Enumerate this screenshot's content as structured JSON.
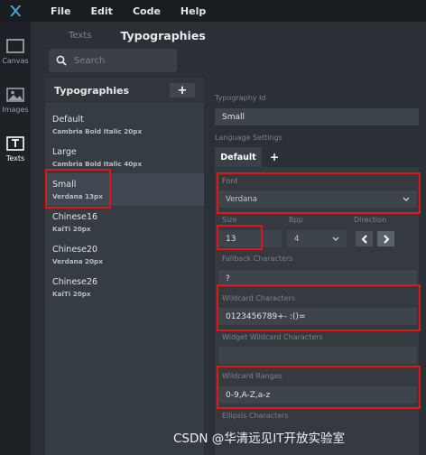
{
  "menu": [
    "File",
    "Edit",
    "Code",
    "Help"
  ],
  "rail": [
    {
      "label": "Canvas",
      "icon": "canvas-icon"
    },
    {
      "label": "Images",
      "icon": "images-icon"
    },
    {
      "label": "Texts",
      "icon": "texts-icon"
    }
  ],
  "header": {
    "tab": "Texts",
    "title": "Typographies"
  },
  "search": {
    "placeholder": "Search"
  },
  "list": {
    "title": "Typographies",
    "add_label": "+",
    "items": [
      {
        "name": "Default",
        "sub": "Cambria Bold Italic 20px"
      },
      {
        "name": "Large",
        "sub": "Cambria Bold Italic 40px"
      },
      {
        "name": "Small",
        "sub": "Verdana 13px"
      },
      {
        "name": "Chinese16",
        "sub": "KaiTi 20px"
      },
      {
        "name": "Chinese20",
        "sub": "Verdana 20px"
      },
      {
        "name": "Chinese26",
        "sub": "KaiTi 20px"
      }
    ]
  },
  "props": {
    "typography_id_label": "Typography Id",
    "typography_id_value": "Small",
    "language_settings_label": "Language Settings",
    "lang_tab": "Default",
    "lang_add": "+",
    "font_label": "Font",
    "font_value": "Verdana",
    "size_label": "Size",
    "size_value": "13",
    "bpp_label": "Bpp",
    "bpp_value": "4",
    "direction_label": "Direction",
    "fallback_label": "Fallback Characters",
    "fallback_value": "?",
    "wildcard_label": "Wildcard Characters",
    "wildcard_value": "0123456789+- :()=",
    "widget_wildcard_label": "Widget Wildcard Characters",
    "widget_wildcard_value": "",
    "wildcard_ranges_label": "Wildcard Ranges",
    "wildcard_ranges_value": "0-9,A-Z,a-z",
    "ellipsis_label": "Ellipsis Characters"
  },
  "watermark": "CSDN @华清远见IT开放实验室",
  "colors": {
    "highlight": "#e0161b",
    "logo": "#4aa3df"
  }
}
